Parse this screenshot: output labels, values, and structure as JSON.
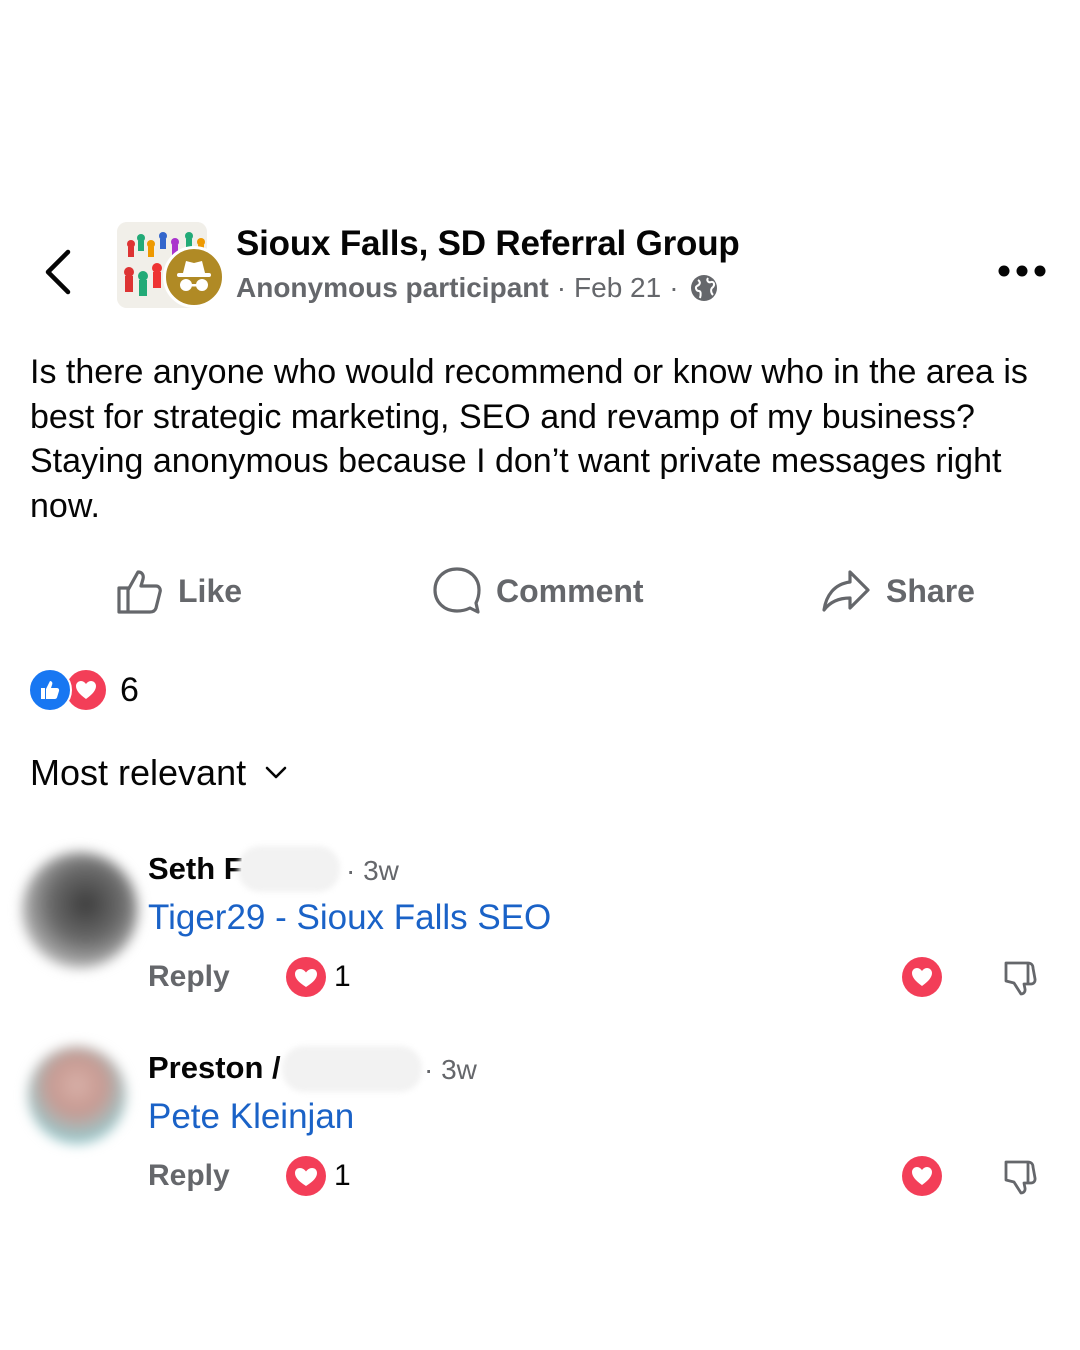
{
  "header": {
    "group_name": "Sioux Falls, SD Referral Group",
    "author": "Anonymous participant",
    "separator": "·",
    "date": "Feb 21",
    "icons": {
      "back": "chevron-left-icon",
      "privacy": "globe-icon",
      "more": "more-horizontal-icon"
    }
  },
  "post": {
    "text": "Is there anyone who would recommend or know who in the area is best for strategic marketing, SEO and revamp of my business? Staying anonymous because I don’t want private messages right now."
  },
  "actions": {
    "like": "Like",
    "comment": "Comment",
    "share": "Share"
  },
  "reactions": {
    "count": "6",
    "types": [
      "like",
      "love"
    ]
  },
  "sort": {
    "label": "Most relevant"
  },
  "comments": [
    {
      "name": "Seth F",
      "time": "· 3w",
      "text": "Tiger29 - Sioux Falls SEO",
      "reply": "Reply",
      "love_count": "1"
    },
    {
      "name": "Preston /",
      "time": "· 3w",
      "text": "Pete Kleinjan",
      "reply": "Reply",
      "love_count": "1"
    }
  ],
  "colors": {
    "link": "#1a62c7",
    "secondary_text": "#65676b",
    "like_blue": "#1877f2",
    "love_red": "#f33e58",
    "anon_badge": "#b08a25"
  }
}
